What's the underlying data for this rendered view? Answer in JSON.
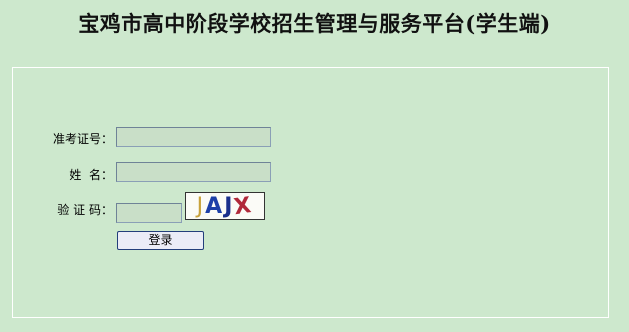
{
  "header": {
    "title": "宝鸡市高中阶段学校招生管理与服务平台(学生端)"
  },
  "form": {
    "exam_id": {
      "label": "准考证号：",
      "value": "",
      "placeholder": ""
    },
    "name": {
      "label": "姓  名：",
      "value": "",
      "placeholder": ""
    },
    "captcha": {
      "label": "验 证 码：",
      "value": "",
      "placeholder": "",
      "image_text": [
        "J",
        "A",
        "J",
        "X"
      ]
    },
    "login_label": "登录"
  },
  "colors": {
    "background": "#cde8cd",
    "input_background": "#c9dfc8",
    "button_border": "#233e7b"
  }
}
